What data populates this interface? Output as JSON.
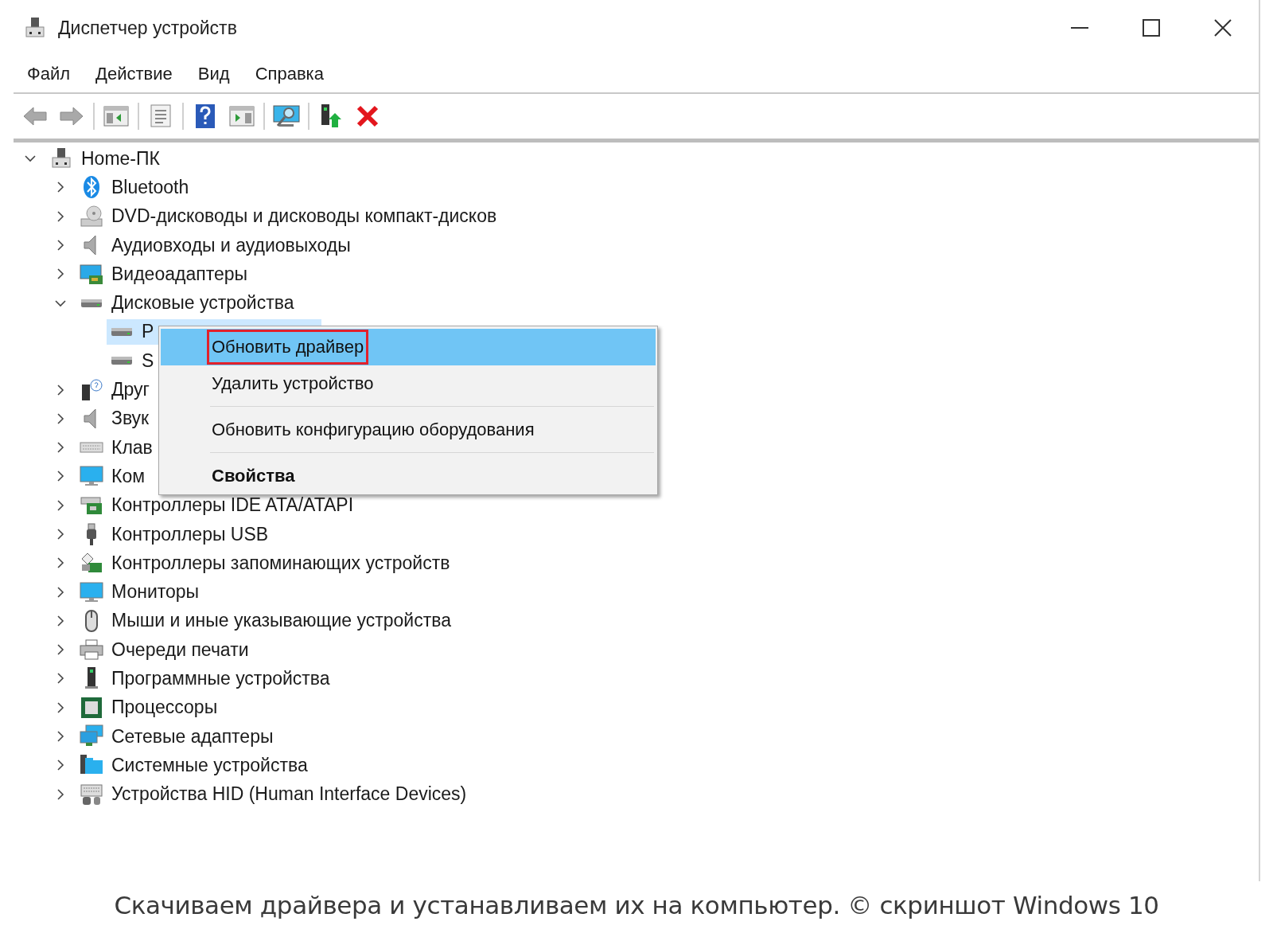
{
  "window": {
    "title": "Диспетчер устройств"
  },
  "menu": [
    {
      "label": "Файл"
    },
    {
      "label": "Действие"
    },
    {
      "label": "Вид"
    },
    {
      "label": "Справка"
    }
  ],
  "toolbar": [
    {
      "kind": "back",
      "disabled": true
    },
    {
      "kind": "forward",
      "disabled": true
    },
    {
      "kind": "separator"
    },
    {
      "kind": "console-tree"
    },
    {
      "kind": "separator"
    },
    {
      "kind": "properties"
    },
    {
      "kind": "separator"
    },
    {
      "kind": "help"
    },
    {
      "kind": "action-pane"
    },
    {
      "kind": "separator"
    },
    {
      "kind": "scan"
    },
    {
      "kind": "separator"
    },
    {
      "kind": "update-driver"
    },
    {
      "kind": "uninstall"
    }
  ],
  "tree": {
    "label": "Home-ПК",
    "expanded": true,
    "children": [
      {
        "label": "Bluetooth",
        "expanded": false
      },
      {
        "label": "DVD-дисководы и дисководы компакт-дисков",
        "expanded": false
      },
      {
        "label": "Аудиовходы и аудиовыходы",
        "expanded": false
      },
      {
        "label": "Видеоадаптеры",
        "expanded": false
      },
      {
        "label": "Дисковые устройства",
        "expanded": true,
        "children": [
          {
            "label": "P",
            "selected": true
          },
          {
            "label": "S",
            "selected": false
          }
        ]
      },
      {
        "label": "Друг",
        "expanded": false
      },
      {
        "label": "Звук",
        "expanded": false
      },
      {
        "label": "Клав",
        "expanded": false
      },
      {
        "label": "Ком",
        "expanded": false
      },
      {
        "label": "Контроллеры IDE ATA/ATAPI",
        "expanded": false
      },
      {
        "label": "Контроллеры USB",
        "expanded": false
      },
      {
        "label": "Контроллеры запоминающих устройств",
        "expanded": false
      },
      {
        "label": "Мониторы",
        "expanded": false
      },
      {
        "label": "Мыши и иные указывающие устройства",
        "expanded": false
      },
      {
        "label": "Очереди печати",
        "expanded": false
      },
      {
        "label": "Программные устройства",
        "expanded": false
      },
      {
        "label": "Процессоры",
        "expanded": false
      },
      {
        "label": "Сетевые адаптеры",
        "expanded": false
      },
      {
        "label": "Системные устройства",
        "expanded": false
      },
      {
        "label": "Устройства HID (Human Interface Devices)",
        "expanded": false
      }
    ]
  },
  "context_menu": {
    "items": [
      {
        "kind": "item",
        "label": "Обновить драйвер",
        "selected": true,
        "bold": false,
        "marked": true
      },
      {
        "kind": "item",
        "label": "Удалить устройство",
        "selected": false,
        "bold": false,
        "marked": false
      },
      {
        "kind": "separator"
      },
      {
        "kind": "item",
        "label": "Обновить конфигурацию оборудования",
        "selected": false,
        "bold": false,
        "marked": false
      },
      {
        "kind": "separator"
      },
      {
        "kind": "item",
        "label": "Свойства",
        "selected": false,
        "bold": true,
        "marked": false
      }
    ]
  },
  "caption": "Скачиваем драйвера и устанавливаем их на компьютер. © скриншот Windows 10"
}
